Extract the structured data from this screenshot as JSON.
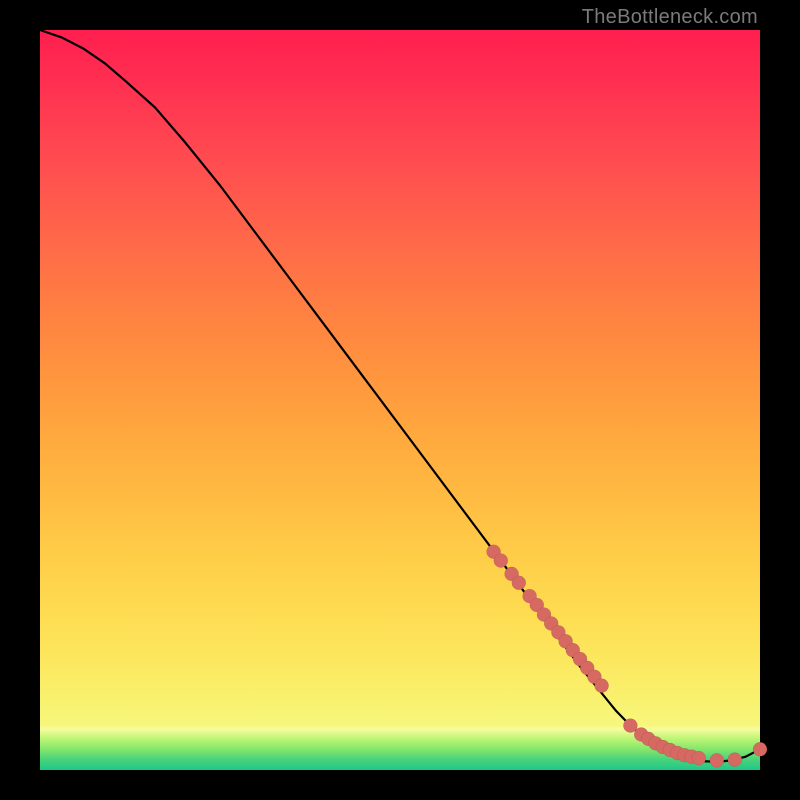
{
  "watermark": "TheBottleneck.com",
  "colors": {
    "background": "#000000",
    "curve": "#000000",
    "marker": "#d66a63"
  },
  "chart_data": {
    "type": "line",
    "title": "",
    "xlabel": "",
    "ylabel": "",
    "xlim": [
      0,
      100
    ],
    "ylim": [
      0,
      100
    ],
    "grid": false,
    "legend": false,
    "series": [
      {
        "name": "curve",
        "x": [
          0,
          3,
          6,
          9,
          12,
          16,
          20,
          25,
          30,
          35,
          40,
          45,
          50,
          55,
          60,
          65,
          70,
          75,
          80,
          82,
          84,
          86,
          88,
          90,
          92,
          94,
          96,
          98,
          100
        ],
        "y": [
          100,
          99,
          97.5,
          95.5,
          93,
          89.5,
          85,
          79,
          72.5,
          66,
          59.5,
          53,
          46.5,
          40,
          33.5,
          27,
          20.5,
          14,
          8,
          6,
          4.3,
          3,
          2.1,
          1.5,
          1.2,
          1.1,
          1.3,
          1.8,
          2.8
        ]
      }
    ],
    "markers": {
      "name": "highlighted-points",
      "x": [
        63,
        64,
        65.5,
        66.5,
        68,
        69,
        70,
        71,
        72,
        73,
        74,
        75,
        76,
        77,
        78,
        82,
        83.5,
        84.5,
        85.5,
        86.5,
        87.5,
        88.5,
        89.5,
        90.5,
        91.5,
        94,
        96.5,
        100
      ],
      "y": [
        29.5,
        28.3,
        26.5,
        25.3,
        23.5,
        22.3,
        21,
        19.8,
        18.6,
        17.4,
        16.2,
        15,
        13.8,
        12.6,
        11.4,
        6.0,
        4.8,
        4.2,
        3.6,
        3.1,
        2.7,
        2.3,
        2.0,
        1.8,
        1.6,
        1.3,
        1.4,
        2.8
      ]
    }
  }
}
